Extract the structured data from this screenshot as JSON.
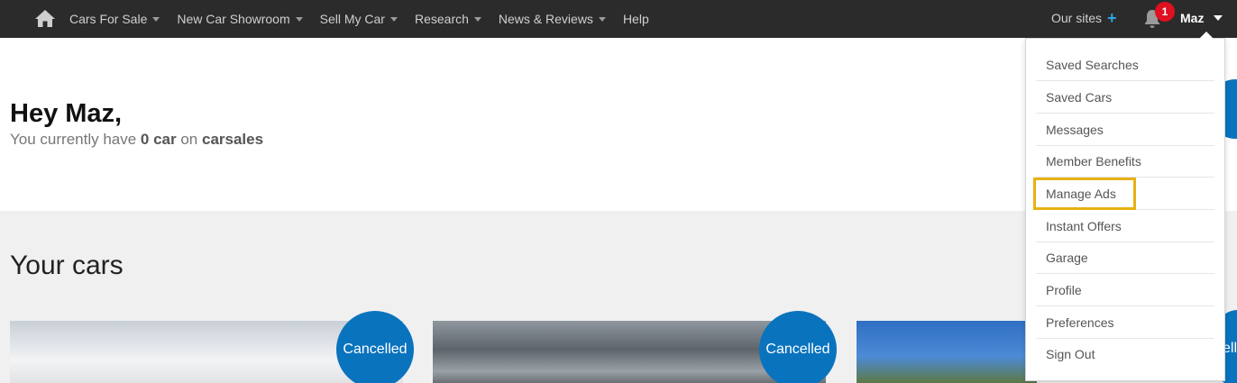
{
  "nav": {
    "items": [
      {
        "label": "Cars For Sale",
        "has_caret": true
      },
      {
        "label": "New Car Showroom",
        "has_caret": true
      },
      {
        "label": "Sell My Car",
        "has_caret": true
      },
      {
        "label": "Research",
        "has_caret": true
      },
      {
        "label": "News & Reviews",
        "has_caret": true
      },
      {
        "label": "Help",
        "has_caret": false
      }
    ],
    "our_sites": "Our sites",
    "our_sites_icon": "+",
    "notification_count": "1",
    "user_name": "Maz"
  },
  "greeting": {
    "title": "Hey Maz,",
    "pre": "You currently have ",
    "count": "0 car",
    "mid": " on ",
    "brand": "carsales"
  },
  "cars": {
    "title": "Your cars",
    "status_labels": [
      "Cancelled",
      "Cancelled",
      "ell"
    ]
  },
  "user_menu": {
    "items": [
      "Saved Searches",
      "Saved Cars",
      "Messages",
      "Member Benefits",
      "Manage Ads",
      "Instant Offers",
      "Garage",
      "Profile",
      "Preferences",
      "Sign Out"
    ],
    "highlighted": "Manage Ads"
  },
  "colors": {
    "nav_bg": "#2b2b2b",
    "accent_blue": "#0a73be",
    "badge_red": "#e01020",
    "highlight_yellow": "#e8b014"
  }
}
